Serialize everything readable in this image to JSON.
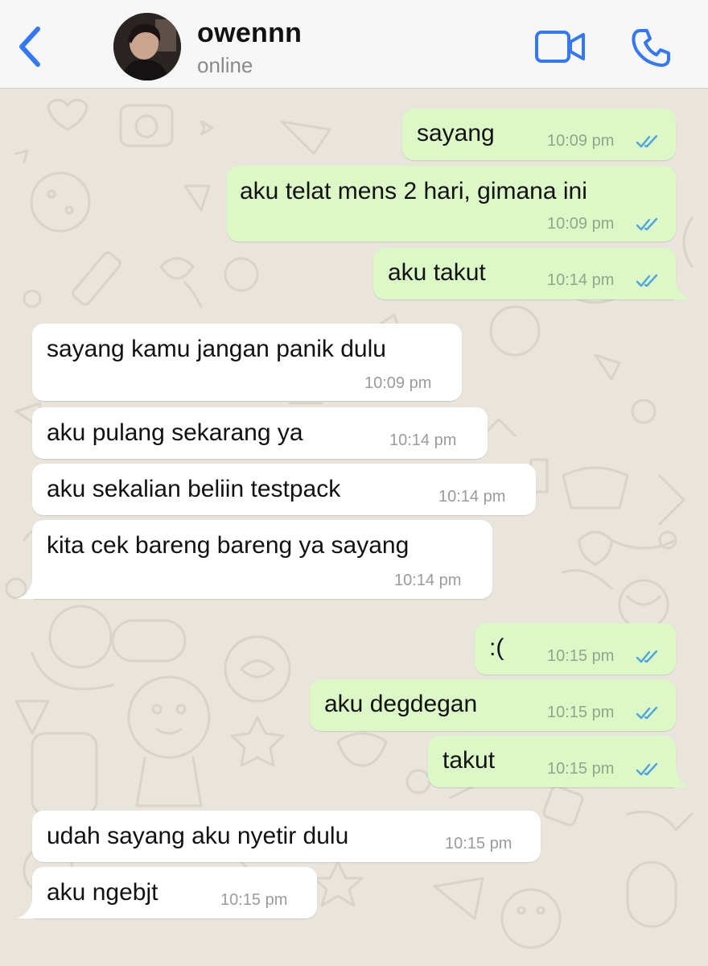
{
  "header": {
    "back_icon": "chevron-left-icon",
    "contact_name": "owennn",
    "contact_status": "online",
    "video_icon": "video-camera-icon",
    "call_icon": "phone-icon",
    "accent_color": "#3478f6"
  },
  "messages": [
    {
      "direction": "out",
      "text": "sayang",
      "time": "10:09 pm",
      "status": "read"
    },
    {
      "direction": "out",
      "text": "aku telat mens 2 hari, gimana ini",
      "time": "10:09 pm",
      "status": "read"
    },
    {
      "direction": "out",
      "text": "aku takut",
      "time": "10:14 pm",
      "status": "read"
    },
    {
      "direction": "in",
      "text": "sayang kamu jangan panik dulu",
      "time": "10:09 pm"
    },
    {
      "direction": "in",
      "text": "aku pulang sekarang ya",
      "time": "10:14 pm"
    },
    {
      "direction": "in",
      "text": "aku sekalian beliin testpack",
      "time": "10:14 pm"
    },
    {
      "direction": "in",
      "text": "kita cek bareng bareng ya sayang",
      "time": "10:14 pm"
    },
    {
      "direction": "out",
      "text": ":(",
      "time": "10:15 pm",
      "status": "read"
    },
    {
      "direction": "out",
      "text": "aku degdegan",
      "time": "10:15 pm",
      "status": "read"
    },
    {
      "direction": "out",
      "text": "takut",
      "time": "10:15 pm",
      "status": "read"
    },
    {
      "direction": "in",
      "text": "udah sayang aku nyetir dulu",
      "time": "10:15 pm"
    },
    {
      "direction": "in",
      "text": "aku ngebjt",
      "time": "10:15 pm"
    }
  ],
  "colors": {
    "outgoing_bubble": "#dcf8c6",
    "incoming_bubble": "#ffffff",
    "read_ticks": "#4fa3e0",
    "background": "#e9e4dc"
  }
}
